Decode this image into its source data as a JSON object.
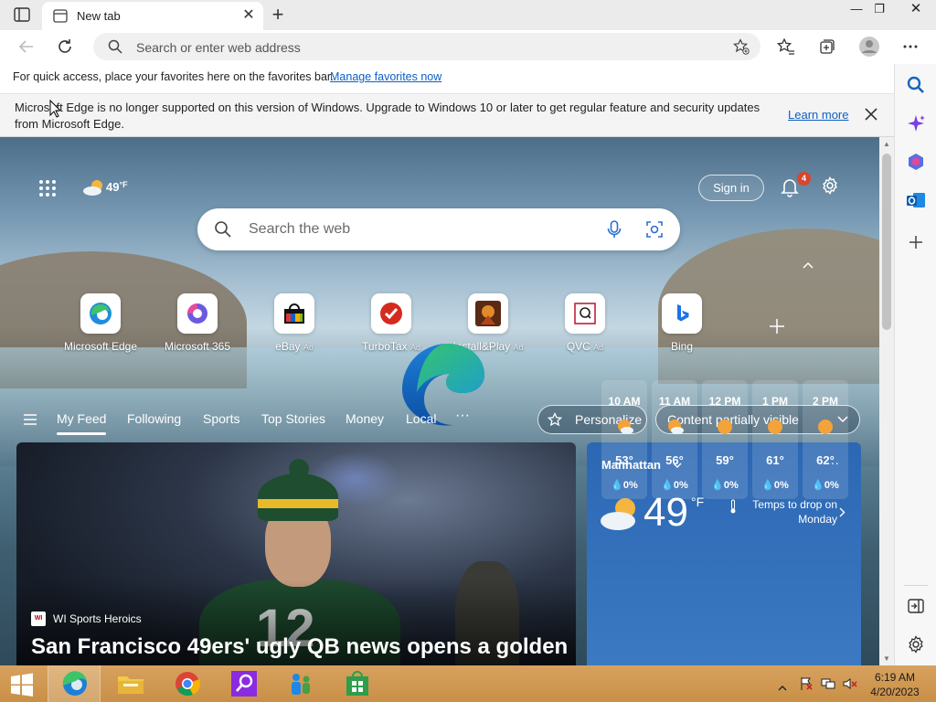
{
  "browser": {
    "tab_title": "New tab",
    "address_placeholder": "Search or enter web address"
  },
  "favorites_bar": {
    "hint": "For quick access, place your favorites here on the favorites bar.",
    "manage_link": "Manage favorites now"
  },
  "banner": {
    "message": "Microsoft Edge is no longer supported on this version of Windows. Upgrade to Windows 10 or later to get regular feature and security updates from Microsoft Edge.",
    "learn_more": "Learn more"
  },
  "header": {
    "weather_temp": "49",
    "weather_unit": "°F",
    "sign_in": "Sign in",
    "notification_count": "4"
  },
  "search": {
    "placeholder": "Search the web"
  },
  "quick_links": [
    {
      "label": "Microsoft Edge",
      "ad": ""
    },
    {
      "label": "Microsoft 365",
      "ad": ""
    },
    {
      "label": "eBay",
      "ad": "Ad"
    },
    {
      "label": "TurboTax",
      "ad": "Ad"
    },
    {
      "label": "Install&Play",
      "ad": "Ad"
    },
    {
      "label": "QVC",
      "ad": "Ad"
    },
    {
      "label": "Bing",
      "ad": ""
    }
  ],
  "feed": {
    "tabs": [
      "My Feed",
      "Following",
      "Sports",
      "Top Stories",
      "Money",
      "Local"
    ],
    "more": "···",
    "personalize": "Personalize",
    "content_visibility": "Content partially visible"
  },
  "hero": {
    "source": "WI Sports Heroics",
    "headline": "San Francisco 49ers' ugly QB news opens a golden"
  },
  "weather_card": {
    "location": "Manhattan",
    "temperature": "49",
    "unit": "°F",
    "summary": "Temps to drop on Monday",
    "hourly": [
      {
        "time": "10 AM",
        "temp": "53°",
        "precip": "0%",
        "icon": "partly-cloudy"
      },
      {
        "time": "11 AM",
        "temp": "56°",
        "precip": "0%",
        "icon": "partly-cloudy"
      },
      {
        "time": "12 PM",
        "temp": "59°",
        "precip": "0%",
        "icon": "sunny"
      },
      {
        "time": "1 PM",
        "temp": "61°",
        "precip": "0%",
        "icon": "sunny"
      },
      {
        "time": "2 PM",
        "temp": "62°",
        "precip": "0%",
        "icon": "sunny"
      }
    ]
  },
  "taskbar": {
    "time": "6:19 AM",
    "date": "4/20/2023"
  },
  "colors": {
    "accent": "#0d5fc5",
    "weather_card": "#2c67b3",
    "taskbar": "#d19a52"
  }
}
